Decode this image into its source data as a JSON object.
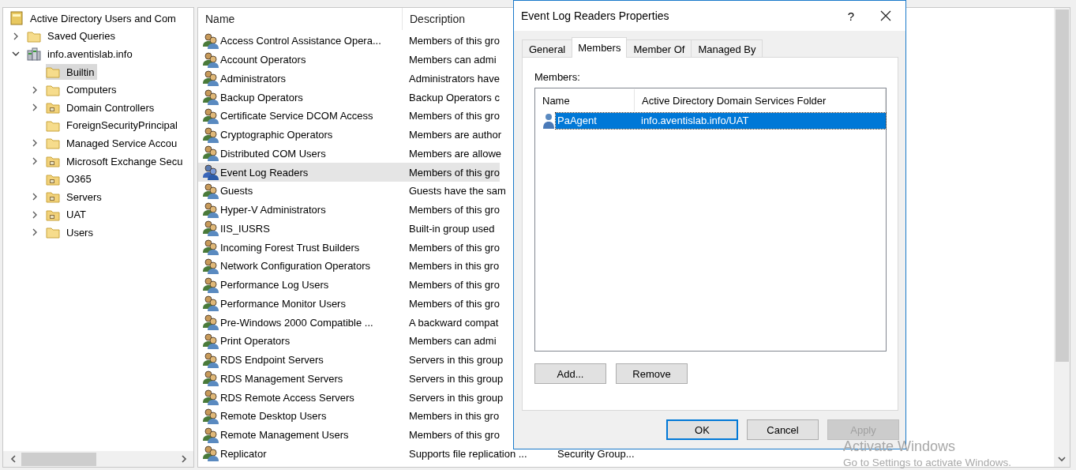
{
  "tree": {
    "items": [
      {
        "label": "Active Directory Users and Com",
        "kind": "root",
        "selected": false,
        "children": [
          {
            "label": "Saved Queries",
            "kind": "folder",
            "expanded": false,
            "selected": false
          },
          {
            "label": "info.aventislab.info",
            "kind": "domain",
            "expanded": true,
            "selected": false,
            "children": [
              {
                "label": "Builtin",
                "kind": "folder",
                "selected": true
              },
              {
                "label": "Computers",
                "kind": "folder",
                "expanded": false,
                "selected": false
              },
              {
                "label": "Domain Controllers",
                "kind": "ou",
                "expanded": false,
                "selected": false
              },
              {
                "label": "ForeignSecurityPrincipal",
                "kind": "folder",
                "selected": false
              },
              {
                "label": "Managed Service Accou",
                "kind": "folder",
                "expanded": false,
                "selected": false
              },
              {
                "label": "Microsoft Exchange Secu",
                "kind": "ou",
                "expanded": false,
                "selected": false
              },
              {
                "label": "O365",
                "kind": "ou",
                "selected": false
              },
              {
                "label": "Servers",
                "kind": "ou",
                "expanded": false,
                "selected": false
              },
              {
                "label": "UAT",
                "kind": "ou",
                "expanded": false,
                "selected": false
              },
              {
                "label": "Users",
                "kind": "folder",
                "expanded": false,
                "selected": false
              }
            ]
          }
        ]
      }
    ]
  },
  "list": {
    "columns": [
      "Name",
      "Description"
    ],
    "rows": [
      {
        "name": "Access Control Assistance Opera...",
        "description": "Members of this gro",
        "selected": false
      },
      {
        "name": "Account Operators",
        "description": "Members can admi",
        "selected": false
      },
      {
        "name": "Administrators",
        "description": "Administrators have",
        "selected": false
      },
      {
        "name": "Backup Operators",
        "description": "Backup Operators c",
        "selected": false
      },
      {
        "name": "Certificate Service DCOM Access",
        "description": "Members of this gro",
        "selected": false
      },
      {
        "name": "Cryptographic Operators",
        "description": "Members are author",
        "selected": false
      },
      {
        "name": "Distributed COM Users",
        "description": "Members are allowe",
        "selected": false
      },
      {
        "name": "Event Log Readers",
        "description": "Members of this gro",
        "selected": true
      },
      {
        "name": "Guests",
        "description": "Guests have the sam",
        "selected": false
      },
      {
        "name": "Hyper-V Administrators",
        "description": "Members of this gro",
        "selected": false
      },
      {
        "name": "IIS_IUSRS",
        "description": "Built-in group used",
        "selected": false
      },
      {
        "name": "Incoming Forest Trust Builders",
        "description": "Members of this gro",
        "selected": false
      },
      {
        "name": "Network Configuration Operators",
        "description": "Members in this gro",
        "selected": false
      },
      {
        "name": "Performance Log Users",
        "description": "Members of this gro",
        "selected": false
      },
      {
        "name": "Performance Monitor Users",
        "description": "Members of this gro",
        "selected": false
      },
      {
        "name": "Pre-Windows 2000 Compatible ...",
        "description": "A backward compat",
        "selected": false
      },
      {
        "name": "Print Operators",
        "description": "Members can admi",
        "selected": false
      },
      {
        "name": "RDS Endpoint Servers",
        "description": "Servers in this group",
        "selected": false
      },
      {
        "name": "RDS Management Servers",
        "description": "Servers in this group",
        "selected": false
      },
      {
        "name": "RDS Remote Access Servers",
        "description": "Servers in this group",
        "selected": false
      },
      {
        "name": "Remote Desktop Users",
        "description": "Members in this gro",
        "selected": false
      },
      {
        "name": "Remote Management Users",
        "description": "Members of this gro",
        "selected": false
      },
      {
        "name": "Replicator",
        "description": "Supports file replication ...",
        "column_3": "Security Group...",
        "selected": false
      }
    ]
  },
  "dialog": {
    "title": "Event Log Readers Properties",
    "help_button": "?",
    "tabs": [
      {
        "label": "General",
        "selected": false
      },
      {
        "label": "Members",
        "selected": true
      },
      {
        "label": "Member Of",
        "selected": false
      },
      {
        "label": "Managed By",
        "selected": false
      }
    ],
    "members_label": "Members:",
    "members_list": {
      "columns": [
        "Name",
        "Active Directory Domain Services Folder"
      ],
      "rows": [
        {
          "name": "PaAgent",
          "folder": "info.aventislab.info/UAT",
          "selected": true
        }
      ]
    },
    "list_buttons": [
      {
        "label": "Add...",
        "disabled": false
      },
      {
        "label": "Remove",
        "disabled": false
      }
    ],
    "buttons": [
      {
        "label": "OK",
        "kind": "default",
        "disabled": false
      },
      {
        "label": "Cancel",
        "kind": "normal",
        "disabled": false
      },
      {
        "label": "Apply",
        "kind": "normal",
        "disabled": true
      }
    ]
  },
  "activation_notice": {
    "title": "Activate Windows",
    "subtitle": "Go to Settings to activate Windows."
  }
}
